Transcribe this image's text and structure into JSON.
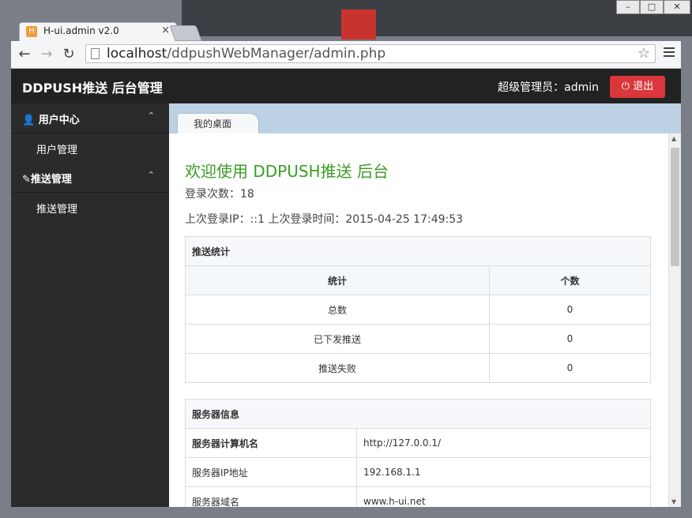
{
  "browser": {
    "tab_title": "H-ui.admin v2.0",
    "tab_close": "×",
    "url_host": "localhost",
    "url_path": "/ddpushWebManager/admin.php",
    "back": "←",
    "forward": "→",
    "reload": "↻",
    "bookmark": "☆",
    "window_controls": [
      "–",
      "□",
      "✕"
    ]
  },
  "header": {
    "brand": "DDPUSH推送 后台管理",
    "admin_label": "超级管理员：admin",
    "logout_label": "退出",
    "logout_icon": "⏻"
  },
  "sidebar": {
    "sections": [
      {
        "label": "用户中心",
        "icon": "user-icon",
        "glyph": "👤",
        "items": [
          "用户管理"
        ]
      },
      {
        "label": "推送管理",
        "icon": "edit-icon",
        "glyph": "✎",
        "items": [
          "推送管理"
        ]
      }
    ],
    "caret": "⌃",
    "collapse_glyph": "◀"
  },
  "page_tabs": [
    "我的桌面"
  ],
  "welcome": "欢迎使用 DDPUSH推送 后台",
  "login_count": "登录次数：18",
  "last_login": "上次登录IP：::1 上次登录时间：2015-04-25 17:49:53",
  "push_stats": {
    "caption": "推送统计",
    "columns": [
      "统计",
      "个数"
    ],
    "rows": [
      [
        "总数",
        "0"
      ],
      [
        "已下发推送",
        "0"
      ],
      [
        "推送失败",
        "0"
      ]
    ]
  },
  "server_info": {
    "caption": "服务器信息",
    "rows": [
      [
        "服务器计算机名",
        "http://127.0.0.1/"
      ],
      [
        "服务器IP地址",
        "192.168.1.1"
      ],
      [
        "服务器域名",
        "www.h-ui.net"
      ]
    ]
  },
  "colors": {
    "accent_green": "#3a9d23",
    "logout_red": "#d9373b",
    "header_bg": "#222222",
    "sidebar_bg": "#2b2b2b"
  }
}
